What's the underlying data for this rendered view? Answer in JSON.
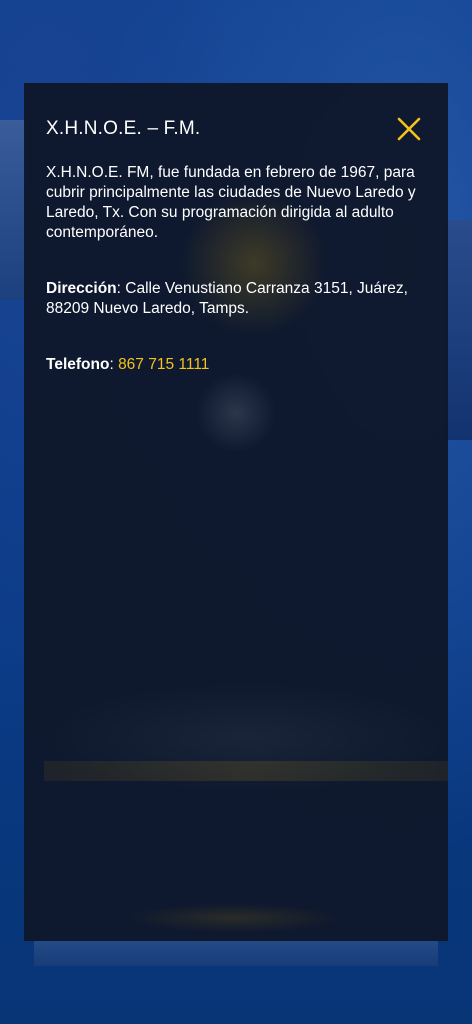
{
  "modal": {
    "title": "X.H.N.O.E. – F.M.",
    "description": "X.H.N.O.E. FM, fue fundada en febrero de 1967, para cubrir principalmente las ciudades de Nuevo Laredo y Laredo, Tx. Con su programación dirigida al adulto contemporáneo.",
    "address_label": "Dirección",
    "address_value": "Calle Venustiano Carranza 3151, Juárez, 88209 Nuevo Laredo, Tamps.",
    "phone_label": "Telefono",
    "phone_value": "867 715 1111",
    "close_icon": "close-icon"
  },
  "colors": {
    "accent": "#f4c21a",
    "modal_bg": "#0e182b",
    "page_bg": "#0a3f8f",
    "text": "#ffffff"
  }
}
